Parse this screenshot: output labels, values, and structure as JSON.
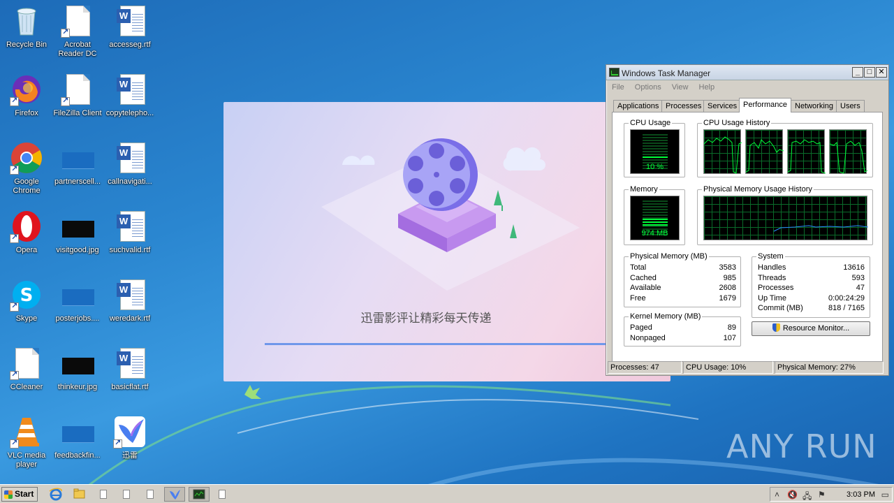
{
  "desktop": {
    "icons": [
      {
        "label": "Recycle Bin",
        "icon": "recycle-bin-icon"
      },
      {
        "label": "Acrobat Reader DC",
        "icon": "document-icon"
      },
      {
        "label": "accesseg.rtf",
        "icon": "word-doc-icon"
      },
      {
        "label": "Firefox",
        "icon": "firefox-icon"
      },
      {
        "label": "FileZilla Client",
        "icon": "document-icon"
      },
      {
        "label": "copytelepho...",
        "icon": "word-doc-icon"
      },
      {
        "label": "Google Chrome",
        "icon": "chrome-icon"
      },
      {
        "label": "partnerscell...",
        "icon": "image-thumbnail-icon"
      },
      {
        "label": "callnavigati...",
        "icon": "word-doc-icon"
      },
      {
        "label": "Opera",
        "icon": "opera-icon"
      },
      {
        "label": "visitgood.jpg",
        "icon": "image-thumbnail-icon"
      },
      {
        "label": "suchvalid.rtf",
        "icon": "word-doc-icon"
      },
      {
        "label": "Skype",
        "icon": "skype-icon"
      },
      {
        "label": "posterjobs....",
        "icon": "image-thumbnail-icon"
      },
      {
        "label": "weredark.rtf",
        "icon": "word-doc-icon"
      },
      {
        "label": "CCleaner",
        "icon": "document-icon"
      },
      {
        "label": "thinkeur.jpg",
        "icon": "image-thumbnail-icon"
      },
      {
        "label": "basicflat.rtf",
        "icon": "word-doc-icon"
      },
      {
        "label": "VLC media player",
        "icon": "vlc-icon"
      },
      {
        "label": "feedbackfin...",
        "icon": "image-thumbnail-icon"
      },
      {
        "label": "迅雷",
        "icon": "thunder-bird-icon"
      }
    ]
  },
  "splash": {
    "tagline": "迅雷影评让精彩每天传递",
    "progress_color": "#6f97ea"
  },
  "task_manager": {
    "title": "Windows Task Manager",
    "menu": [
      "File",
      "Options",
      "View",
      "Help"
    ],
    "tabs": [
      "Applications",
      "Processes",
      "Services",
      "Performance",
      "Networking",
      "Users"
    ],
    "active_tab": "Performance",
    "cpu_usage": {
      "title": "CPU Usage",
      "value": "10 %",
      "percent": 10
    },
    "cpu_history": {
      "title": "CPU Usage History"
    },
    "memory": {
      "title": "Memory",
      "value": "974 MB",
      "fraction": 0.27
    },
    "memory_history": {
      "title": "Physical Memory Usage History"
    },
    "physical_memory": {
      "title": "Physical Memory (MB)",
      "rows": [
        {
          "label": "Total",
          "value": "3583"
        },
        {
          "label": "Cached",
          "value": "985"
        },
        {
          "label": "Available",
          "value": "2608"
        },
        {
          "label": "Free",
          "value": "1679"
        }
      ]
    },
    "kernel_memory": {
      "title": "Kernel Memory (MB)",
      "rows": [
        {
          "label": "Paged",
          "value": "89"
        },
        {
          "label": "Nonpaged",
          "value": "107"
        }
      ]
    },
    "system": {
      "title": "System",
      "rows": [
        {
          "label": "Handles",
          "value": "13616"
        },
        {
          "label": "Threads",
          "value": "593"
        },
        {
          "label": "Processes",
          "value": "47"
        },
        {
          "label": "Up Time",
          "value": "0:00:24:29"
        },
        {
          "label": "Commit (MB)",
          "value": "818 / 7165"
        }
      ]
    },
    "resource_monitor_button": "Resource Monitor...",
    "status": {
      "processes": "Processes: 47",
      "cpu": "CPU Usage: 10%",
      "memory": "Physical Memory: 27%"
    },
    "graph_color": "#00ff3a"
  },
  "taskbar": {
    "start_label": "Start",
    "clock": "3:03 PM"
  },
  "watermark": "ANY RUN"
}
